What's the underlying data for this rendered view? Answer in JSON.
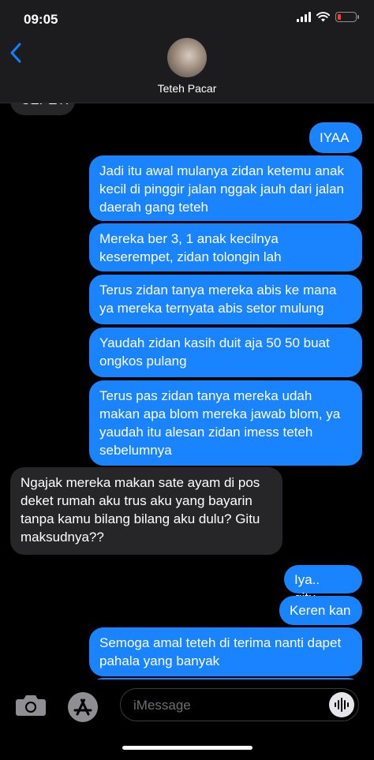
{
  "status": {
    "time": "09:05"
  },
  "header": {
    "contact_name": "Teteh Pacar"
  },
  "messages": [
    {
      "type": "received",
      "text": "CEPET!"
    },
    {
      "type": "sent",
      "text": "IYAA"
    },
    {
      "type": "sent",
      "text": "Jadi itu awal mulanya zidan ketemu anak kecil di pinggir jalan nggak jauh dari jalan daerah gang teteh"
    },
    {
      "type": "sent",
      "text": "Mereka ber 3, 1 anak kecilnya keserempet, zidan tolongin lah"
    },
    {
      "type": "sent",
      "text": "Terus zidan tanya mereka abis ke mana ya mereka ternyata abis setor mulung"
    },
    {
      "type": "sent",
      "text": "Yaudah zidan kasih duit aja 50 50 buat ongkos pulang"
    },
    {
      "type": "sent",
      "text": "Terus pas zidan tanya mereka udah makan apa blom mereka jawab blom, ya yaudah itu alesan zidan imess teteh sebelumnya"
    },
    {
      "type": "received",
      "text": "Ngajak mereka makan sate ayam di pos deket rumah aku trus aku yang bayarin tanpa kamu bilang bilang aku dulu? Gitu maksudnya??"
    },
    {
      "type": "sent",
      "text": "Iya.. gitu.."
    },
    {
      "type": "sent",
      "text": "Keren kan"
    },
    {
      "type": "sent",
      "text": "Semoga amal teteh di terima nanti dapet pahala yang banyak"
    }
  ],
  "input": {
    "placeholder": "iMessage"
  },
  "icons": {
    "back": "chevron-left-icon",
    "camera": "camera-icon",
    "apps": "app-store-icon",
    "audio": "waveform-icon"
  },
  "colors": {
    "sent_bubble": "#1a84ff",
    "received_bubble": "#262628",
    "accent": "#0a84ff"
  }
}
